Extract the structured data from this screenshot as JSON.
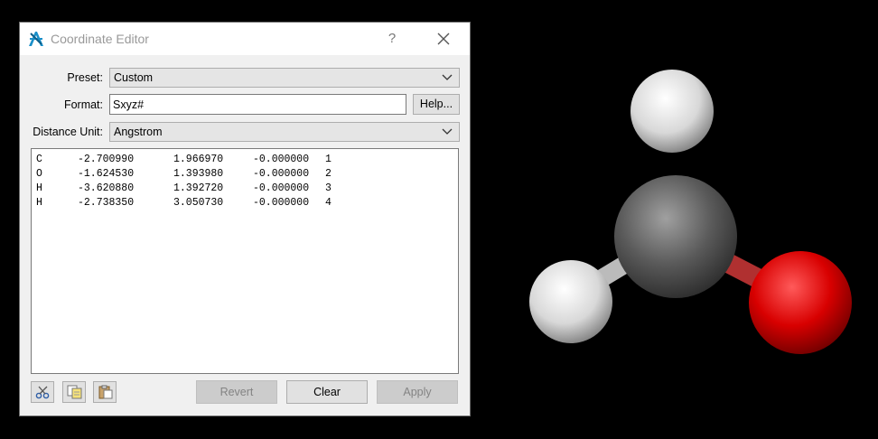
{
  "window": {
    "title": "Coordinate Editor",
    "help_glyph": "?",
    "close_glyph": "✕"
  },
  "form": {
    "preset_label": "Preset:",
    "preset_value": "Custom",
    "format_label": "Format:",
    "format_value": "Sxyz#",
    "help_button": "Help...",
    "unit_label": "Distance Unit:",
    "unit_value": "Angstrom"
  },
  "coordinates": [
    {
      "symbol": "C",
      "x": "-2.700990",
      "y": "1.966970",
      "z": "-0.000000",
      "index": "1"
    },
    {
      "symbol": "O",
      "x": "-1.624530",
      "y": "1.393980",
      "z": "-0.000000",
      "index": "2"
    },
    {
      "symbol": "H",
      "x": "-3.620880",
      "y": "1.392720",
      "z": "-0.000000",
      "index": "3"
    },
    {
      "symbol": "H",
      "x": "-2.738350",
      "y": "3.050730",
      "z": "-0.000000",
      "index": "4"
    }
  ],
  "buttons": {
    "revert": "Revert",
    "clear": "Clear",
    "apply": "Apply"
  },
  "icons": {
    "app": "avogadro-icon",
    "cut": "cut-icon",
    "copy": "copy-icon",
    "paste": "paste-icon"
  },
  "colors": {
    "carbon": "#555555",
    "oxygen": "#e00000",
    "hydrogen": "#e8e8e8",
    "background": "#000000"
  }
}
